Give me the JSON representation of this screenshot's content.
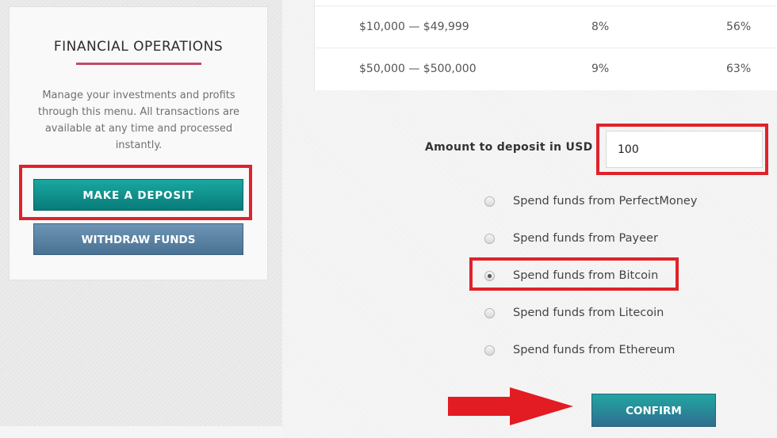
{
  "sidebar": {
    "title": "FINANCIAL OPERATIONS",
    "description": "Manage your investments and profits through this menu. All transactions are available at any time and processed instantly.",
    "deposit_button": "MAKE A DEPOSIT",
    "withdraw_button": "WITHDRAW FUNDS"
  },
  "plans_table": {
    "rows": [
      {
        "range": "$10,000 — $49,999",
        "rate": "8%",
        "total": "56%"
      },
      {
        "range": "$50,000 — $500,000",
        "rate": "9%",
        "total": "63%"
      }
    ]
  },
  "deposit_form": {
    "amount_label": "Amount to deposit in USD",
    "amount_value": "100",
    "payment_options": [
      {
        "label": "Spend funds from PerfectMoney",
        "selected": false
      },
      {
        "label": "Spend funds from Payeer",
        "selected": false
      },
      {
        "label": "Spend funds from Bitcoin",
        "selected": true
      },
      {
        "label": "Spend funds from Litecoin",
        "selected": false
      },
      {
        "label": "Spend funds from Ethereum",
        "selected": false
      }
    ],
    "confirm_button": "CONFIRM"
  },
  "colors": {
    "deposit_button": "#0c8d89",
    "withdraw_button": "#5a82a3",
    "confirm_button": "#27898f",
    "accent_line": "#c24c69",
    "highlight": "#e0222a"
  },
  "annotations": {
    "arrow_icon": "red-arrow-right-icon"
  }
}
